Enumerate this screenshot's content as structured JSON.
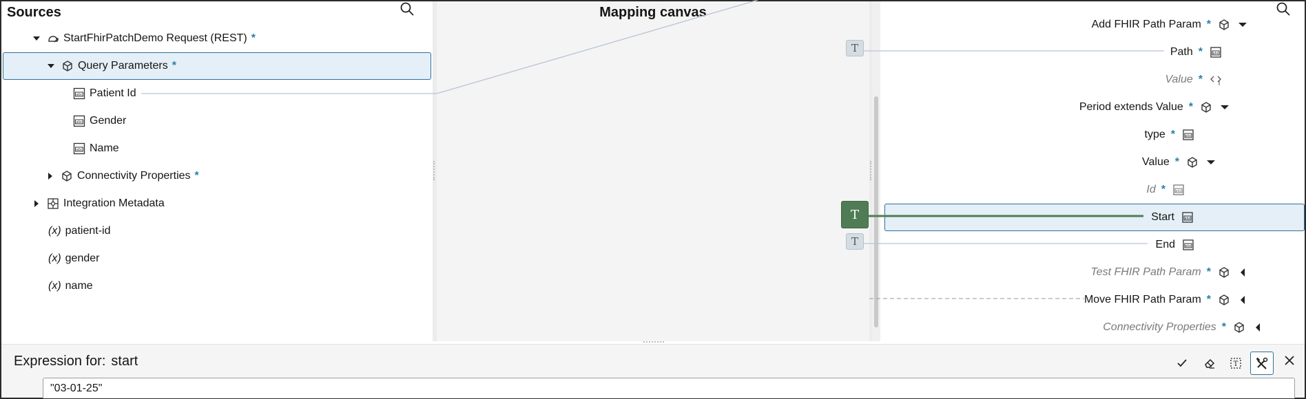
{
  "sources": {
    "title": "Sources",
    "tree": [
      {
        "label": "StartFhirPatchDemo Request (REST)",
        "required": "*",
        "expanded": true,
        "icon": "rest-request-icon"
      },
      {
        "label": "Query Parameters",
        "required": "*",
        "expanded": true,
        "icon": "cube-icon",
        "selected": true
      },
      {
        "label": "Patient Id",
        "icon": "text-field-icon"
      },
      {
        "label": "Gender",
        "icon": "text-field-icon"
      },
      {
        "label": "Name",
        "icon": "text-field-icon"
      },
      {
        "label": "Connectivity Properties",
        "required": "*",
        "expanded": false,
        "icon": "cube-icon"
      },
      {
        "label": "Integration Metadata",
        "expanded": false,
        "icon": "metadata-icon"
      },
      {
        "prefix": "(x)",
        "label": "patient-id"
      },
      {
        "prefix": "(x)",
        "label": "gender"
      },
      {
        "prefix": "(x)",
        "label": "name"
      }
    ]
  },
  "canvas": {
    "title": "Mapping canvas",
    "function_chip": "T"
  },
  "targets": {
    "rows": [
      {
        "label": "Add FHIR Path Param",
        "required": "*",
        "icon": "cube-icon",
        "caret": "down"
      },
      {
        "label": "Path",
        "required": "*",
        "icon": "text-field-icon"
      },
      {
        "label": "Value",
        "required": "*",
        "icon": "code-icon",
        "italic": true
      },
      {
        "label": "Period extends Value",
        "required": "*",
        "icon": "cube-icon",
        "caret": "down"
      },
      {
        "label": "type",
        "required": "*",
        "icon": "text-field-icon"
      },
      {
        "label": "Value",
        "required": "*",
        "icon": "cube-icon",
        "caret": "down"
      },
      {
        "label": "Id",
        "required": "*",
        "icon": "text-field-icon",
        "italic": true
      },
      {
        "label": "Start",
        "icon": "text-field-icon",
        "selected": true
      },
      {
        "label": "End",
        "icon": "text-field-icon"
      },
      {
        "label": "Test FHIR Path Param",
        "required": "*",
        "icon": "cube-icon",
        "caret": "left",
        "italic": true
      },
      {
        "label": "Move FHIR Path Param",
        "required": "*",
        "icon": "cube-icon",
        "caret": "left"
      },
      {
        "label": "Connectivity Properties",
        "required": "*",
        "icon": "cube-icon",
        "caret": "left",
        "italic": true
      }
    ]
  },
  "expression": {
    "title_prefix": "Expression for:",
    "target_name": "start",
    "value": "\"03-01-25\""
  },
  "colors": {
    "accent": "#2f6f9e",
    "selected_bg": "#e4eff7",
    "mapping_active": "#4f7c55",
    "required": "#2a7fa8"
  }
}
